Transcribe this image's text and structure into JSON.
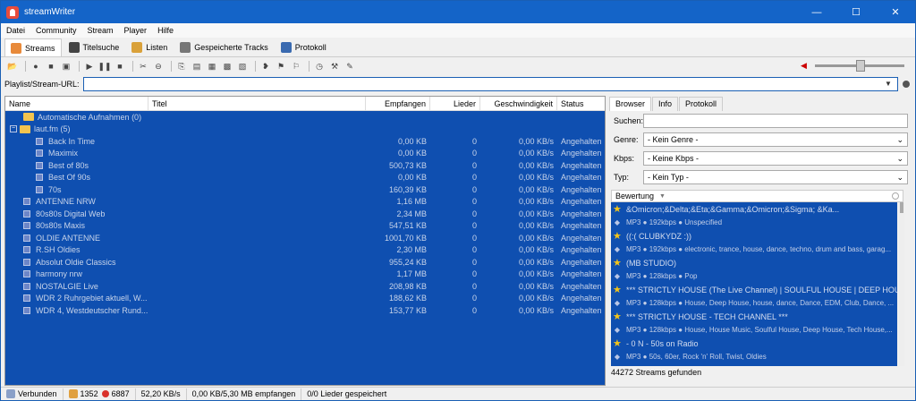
{
  "window": {
    "title": "streamWriter",
    "controls": [
      "—",
      "☐",
      "✕"
    ]
  },
  "menu": [
    "Datei",
    "Community",
    "Stream",
    "Player",
    "Hilfe"
  ],
  "main_tabs": [
    {
      "label": "Streams",
      "icon": "streams-icon"
    },
    {
      "label": "Titelsuche",
      "icon": "title-search-icon"
    },
    {
      "label": "Listen",
      "icon": "lists-icon"
    },
    {
      "label": "Gespeicherte Tracks",
      "icon": "saved-tracks-icon"
    },
    {
      "label": "Protokoll",
      "icon": "log-icon"
    }
  ],
  "url_bar": {
    "label": "Playlist/Stream-URL:",
    "value": ""
  },
  "list": {
    "columns": [
      "Name",
      "Titel",
      "Empfangen",
      "Lieder",
      "Geschwindigkeit",
      "Status"
    ],
    "rows": [
      {
        "name": "Automatische Aufnahmen (0)",
        "type": "folder",
        "received": "",
        "songs": "",
        "speed": "",
        "status": ""
      },
      {
        "name": "laut.fm (5)",
        "type": "category",
        "received": "",
        "songs": "",
        "speed": "",
        "status": ""
      },
      {
        "name": "Back In Time",
        "type": "child",
        "received": "0,00 KB",
        "songs": "0",
        "speed": "0,00 KB/s",
        "status": "Angehalten"
      },
      {
        "name": "Maximix",
        "type": "child",
        "received": "0,00 KB",
        "songs": "0",
        "speed": "0,00 KB/s",
        "status": "Angehalten"
      },
      {
        "name": "Best of 80s",
        "type": "child",
        "received": "500,73 KB",
        "songs": "0",
        "speed": "0,00 KB/s",
        "status": "Angehalten"
      },
      {
        "name": "Best Of 90s",
        "type": "child",
        "received": "0,00 KB",
        "songs": "0",
        "speed": "0,00 KB/s",
        "status": "Angehalten"
      },
      {
        "name": "70s",
        "type": "child",
        "received": "160,39 KB",
        "songs": "0",
        "speed": "0,00 KB/s",
        "status": "Angehalten"
      },
      {
        "name": "ANTENNE NRW",
        "type": "stream",
        "received": "1,16 MB",
        "songs": "0",
        "speed": "0,00 KB/s",
        "status": "Angehalten"
      },
      {
        "name": "80s80s Digital Web",
        "type": "stream",
        "received": "2,34 MB",
        "songs": "0",
        "speed": "0,00 KB/s",
        "status": "Angehalten"
      },
      {
        "name": "80s80s Maxis",
        "type": "stream",
        "received": "547,51 KB",
        "songs": "0",
        "speed": "0,00 KB/s",
        "status": "Angehalten"
      },
      {
        "name": "OLDIE ANTENNE",
        "type": "stream",
        "received": "1001,70 KB",
        "songs": "0",
        "speed": "0,00 KB/s",
        "status": "Angehalten"
      },
      {
        "name": "R.SH Oldies",
        "type": "stream",
        "received": "2,30 MB",
        "songs": "0",
        "speed": "0,00 KB/s",
        "status": "Angehalten"
      },
      {
        "name": "Absolut Oldie Classics",
        "type": "stream",
        "received": "955,24 KB",
        "songs": "0",
        "speed": "0,00 KB/s",
        "status": "Angehalten"
      },
      {
        "name": "harmony nrw",
        "type": "stream",
        "received": "1,17 MB",
        "songs": "0",
        "speed": "0,00 KB/s",
        "status": "Angehalten"
      },
      {
        "name": "NOSTALGIE Live",
        "type": "stream",
        "received": "208,98 KB",
        "songs": "0",
        "speed": "0,00 KB/s",
        "status": "Angehalten"
      },
      {
        "name": "WDR 2 Ruhrgebiet aktuell, W...",
        "type": "stream",
        "received": "188,62 KB",
        "songs": "0",
        "speed": "0,00 KB/s",
        "status": "Angehalten"
      },
      {
        "name": "WDR 4, Westdeutscher Rund...",
        "type": "stream",
        "received": "153,77 KB",
        "songs": "0",
        "speed": "0,00 KB/s",
        "status": "Angehalten"
      }
    ]
  },
  "browser": {
    "tabs": [
      "Browser",
      "Info",
      "Protokoll"
    ],
    "search_label": "Suchen:",
    "search_value": "",
    "genre_label": "Genre:",
    "genre_value": "- Kein Genre -",
    "kbps_label": "Kbps:",
    "kbps_value": "- Keine Kbps -",
    "type_label": "Typ:",
    "type_value": "- Kein Typ -",
    "sort_label": "Bewertung",
    "items": [
      {
        "name": "&Omicron;&Delta;&Eta;&Gamma;&Omicron;&Sigma; &Ka...",
        "meta": "MP3 ● 192kbps ● Unspecified"
      },
      {
        "name": "((:( CLUBKYDZ :))",
        "meta": "MP3 ● 192kbps ● electronic, trance, house, dance, techno, drum and bass, garag..."
      },
      {
        "name": "(MB STUDIO)",
        "meta": "MP3 ● 128kbps ● Pop"
      },
      {
        "name": "*** STRICTLY HOUSE (The Live Channel) | SOULFUL HOUSE | DEEP HOUSE...",
        "meta": "MP3 ● 128kbps ● House, Deep House, house, dance, Dance, EDM, Club, Dance, ..."
      },
      {
        "name": "*** STRICTLY HOUSE - TECH CHANNEL ***",
        "meta": "MP3 ● 128kbps ● House, House Music, Soulful House, Deep House, Tech House,..."
      },
      {
        "name": "- 0 N - 50s on Radio",
        "meta": "MP3 ● 50s, 60er, Rock 'n' Roll, Twist, Oldies"
      },
      {
        "name": "- 0 N - 50s on Radio",
        "meta": ""
      }
    ],
    "found": "44272 Streams gefunden"
  },
  "statusbar": {
    "connection": "Verbunden",
    "users": "1352",
    "recording": "6887",
    "speed": "52,20 KB/s",
    "received": "0,00 KB/5,30 MB empfangen",
    "saved": "0/0 Lieder gespeichert"
  },
  "colors": {
    "titlebar": "#1464c8",
    "selection": "#0f4fb0",
    "star": "#f5c518"
  }
}
